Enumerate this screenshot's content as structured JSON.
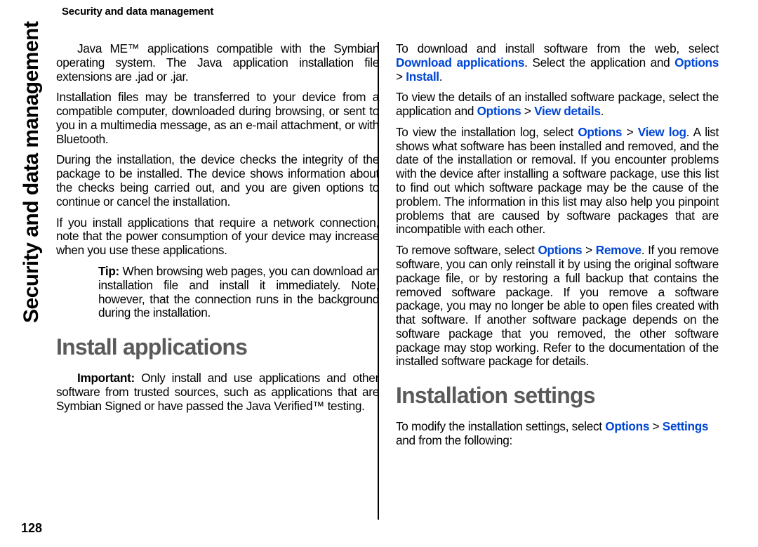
{
  "header": "Security and data management",
  "sideLabel": "Security and data management",
  "pageNumber": "128",
  "left": {
    "p1": "Java ME™ applications compatible with the Symbian operating system. The Java application installation file extensions are .jad or .jar.",
    "p2": "Installation files may be transferred to your device from a compatible computer, downloaded during browsing, or sent to you in a multimedia message, as an e-mail attachment, or with Bluetooth.",
    "p3": "During the installation, the device checks the integrity of the package to be installed. The device shows information about the checks being carried out, and you are given options to continue or cancel the installation.",
    "p4": "If you install applications that require a network connection, note that the power consumption of your device may increase when you use these applications.",
    "tipLabel": "Tip:",
    "tipText": " When browsing web pages, you can download an installation file and install it immediately. Note, however, that the connection runs in the background during the installation.",
    "h2": "Install applications",
    "importantLabel": "Important:",
    "importantText": " Only install and use applications and other software from trusted sources, such as applications that are Symbian Signed or have passed the Java Verified™ testing."
  },
  "right": {
    "p1a": "To download and install software from the web, select ",
    "p1b": "Download applications",
    "p1c": ". Select the application and ",
    "p1d": "Options",
    "p1e": "Install",
    "dot": ".",
    "p2a": "To view the details of an installed software package, select the application and ",
    "p2b": "Options",
    "p2c": "View details",
    "p3a": "To view the installation log, select ",
    "p3b": "Options",
    "p3c": "View log",
    "p3d": ". A list shows what software has been installed and removed, and the date of the installation or removal. If you encounter problems with the device after installing a software package, use this list to find out which software package may be the cause of the problem. The information in this list may also help you pinpoint problems that are caused by software packages that are incompatible with each other.",
    "p4a": "To remove software, select ",
    "p4b": "Options",
    "p4c": "Remove",
    "p4d": ". If you remove software, you can only reinstall it by using the original software package file, or by restoring a full backup that contains the removed software package. If you remove a software package, you may no longer be able to open files created with that software. If another software package depends on the software package that you removed, the other software package may stop working. Refer to the documentation of the installed software package for details.",
    "h2": "Installation settings",
    "p5a": "To modify the installation settings, select ",
    "p5b": "Options",
    "p5c": "Settings",
    "p5d": " and from the following:",
    "gt": " > "
  }
}
